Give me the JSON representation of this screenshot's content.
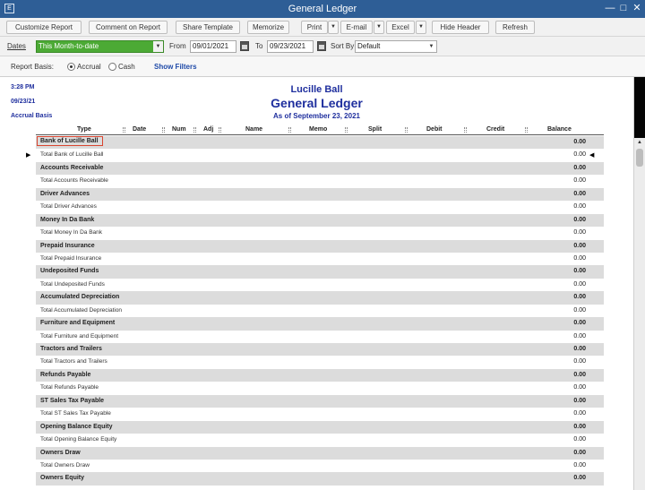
{
  "window": {
    "title": "General Ledger",
    "app_icon": "E",
    "minimize": "—",
    "maximize": "□",
    "close": "✕"
  },
  "toolbar": {
    "customize": "Customize Report",
    "comment": "Comment on Report",
    "share": "Share Template",
    "memorize": "Memorize",
    "print": "Print",
    "email": "E-mail",
    "excel": "Excel",
    "hide_header": "Hide Header",
    "refresh": "Refresh",
    "dropdown_glyph": "▼"
  },
  "filters": {
    "dates_label": "Dates",
    "dates_value": "This Month-to-date",
    "from_label": "From",
    "from_value": "09/01/2021",
    "to_label": "To",
    "to_value": "09/23/2021",
    "sort_label": "Sort By",
    "sort_value": "Default",
    "dropdown_glyph": "▼"
  },
  "basis": {
    "label": "Report Basis:",
    "accrual": "Accrual",
    "cash": "Cash",
    "selected": "accrual",
    "show_filters": "Show Filters"
  },
  "report": {
    "time": "3:28 PM",
    "date": "09/23/21",
    "basis": "Accrual Basis",
    "company": "Lucille Ball",
    "title": "General Ledger",
    "as_of": "As of September 23, 2021",
    "columns": [
      "Type",
      "Date",
      "Num",
      "Adj",
      "Name",
      "Memo",
      "Split",
      "Debit",
      "Credit",
      "Balance"
    ],
    "rows": [
      {
        "name": "Bank of Lucille Ball",
        "balance": "0.00",
        "kind": "header",
        "highlight": true
      },
      {
        "name": "Total Bank of Lucille Ball",
        "balance": "0.00",
        "kind": "total",
        "pointer": true
      },
      {
        "name": "Accounts Receivable",
        "balance": "0.00",
        "kind": "header"
      },
      {
        "name": "Total Accounts Receivable",
        "balance": "0.00",
        "kind": "total"
      },
      {
        "name": "Driver Advances",
        "balance": "0.00",
        "kind": "header"
      },
      {
        "name": "Total Driver Advances",
        "balance": "0.00",
        "kind": "total"
      },
      {
        "name": "Money In Da Bank",
        "balance": "0.00",
        "kind": "header"
      },
      {
        "name": "Total Money In Da Bank",
        "balance": "0.00",
        "kind": "total"
      },
      {
        "name": "Prepaid Insurance",
        "balance": "0.00",
        "kind": "header"
      },
      {
        "name": "Total Prepaid Insurance",
        "balance": "0.00",
        "kind": "total"
      },
      {
        "name": "Undeposited Funds",
        "balance": "0.00",
        "kind": "header"
      },
      {
        "name": "Total Undeposited Funds",
        "balance": "0.00",
        "kind": "total"
      },
      {
        "name": "Accumulated Depreciation",
        "balance": "0.00",
        "kind": "header"
      },
      {
        "name": "Total Accumulated Depreciation",
        "balance": "0.00",
        "kind": "total"
      },
      {
        "name": "Furniture and Equipment",
        "balance": "0.00",
        "kind": "header"
      },
      {
        "name": "Total Furniture and Equipment",
        "balance": "0.00",
        "kind": "total"
      },
      {
        "name": "Tractors and Trailers",
        "balance": "0.00",
        "kind": "header"
      },
      {
        "name": "Total Tractors and Trailers",
        "balance": "0.00",
        "kind": "total"
      },
      {
        "name": "Refunds Payable",
        "balance": "0.00",
        "kind": "header"
      },
      {
        "name": "Total Refunds Payable",
        "balance": "0.00",
        "kind": "total"
      },
      {
        "name": "ST Sales Tax Payable",
        "balance": "0.00",
        "kind": "header"
      },
      {
        "name": "Total ST Sales Tax Payable",
        "balance": "0.00",
        "kind": "total"
      },
      {
        "name": "Opening Balance Equity",
        "balance": "0.00",
        "kind": "header"
      },
      {
        "name": "Total Opening Balance Equity",
        "balance": "0.00",
        "kind": "total"
      },
      {
        "name": "Owners Draw",
        "balance": "0.00",
        "kind": "header"
      },
      {
        "name": "Total Owners Draw",
        "balance": "0.00",
        "kind": "total"
      },
      {
        "name": "Owners Equity",
        "balance": "0.00",
        "kind": "header"
      }
    ]
  },
  "icons": {
    "row_pointer": "▶",
    "col_pointer": "◀",
    "scroll_up": "▲"
  },
  "colors": {
    "titlebar": "#2e5e96",
    "dates_select": "#4caa35",
    "report_text": "#1f2f9e",
    "highlight_border": "#d9442f"
  }
}
